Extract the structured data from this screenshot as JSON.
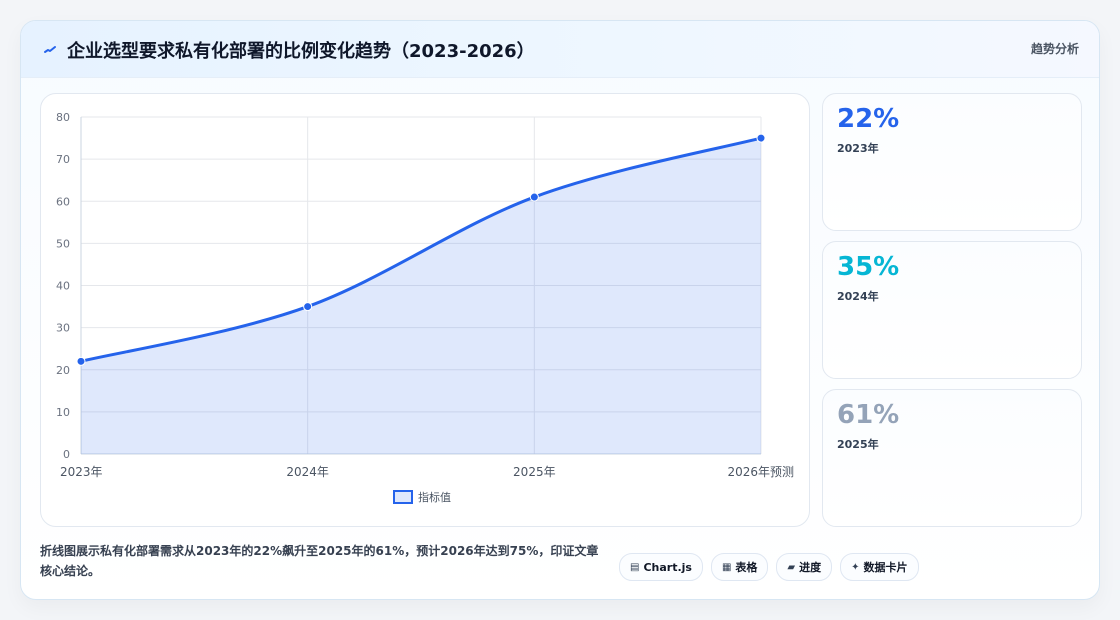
{
  "header": {
    "icon": "spark-line-icon",
    "title": "企业选型要求私有化部署的比例变化趋势（2023-2026）",
    "right_label": "趋势分析"
  },
  "chart_data": {
    "type": "line",
    "x": [
      "2023年",
      "2024年",
      "2025年",
      "2026年预测"
    ],
    "series": [
      {
        "name": "指标值",
        "values": [
          22,
          35,
          61,
          75
        ]
      }
    ],
    "ylim": [
      0,
      80
    ],
    "yticks": [
      0,
      10,
      20,
      30,
      40,
      50,
      60,
      70,
      80
    ],
    "grid": true,
    "legend_position": "bottom"
  },
  "kpis": [
    {
      "value": "22%",
      "label": "2023年",
      "color": "#2563eb"
    },
    {
      "value": "35%",
      "label": "2024年",
      "color": "#06b6d4"
    },
    {
      "value": "61%",
      "label": "2025年",
      "color": "#94a3b8"
    }
  ],
  "caption": "折线图展示私有化部署需求从2023年的22%飙升至2025年的61%，预计2026年达到75%，印证文章核心结论。",
  "tags": [
    {
      "icon": "chart-icon",
      "label": "Chart.js"
    },
    {
      "icon": "table-icon",
      "label": "表格"
    },
    {
      "icon": "progress-icon",
      "label": "进度"
    },
    {
      "icon": "spark-icon",
      "label": "数据卡片"
    }
  ]
}
